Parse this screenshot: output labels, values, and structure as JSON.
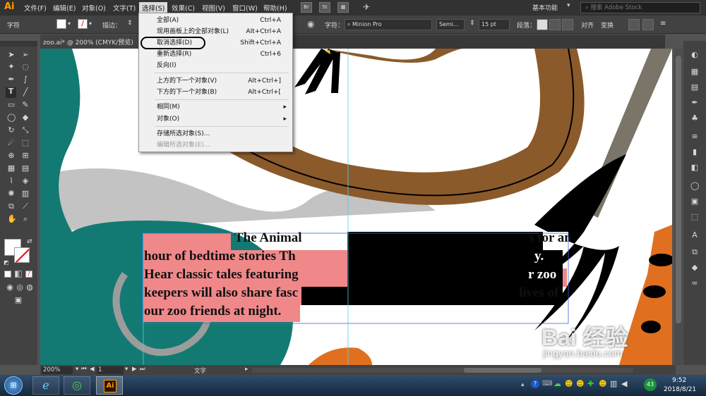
{
  "app": {
    "logo": "Ai"
  },
  "menubar": {
    "items": [
      "文件(F)",
      "编辑(E)",
      "对象(O)",
      "文字(T)",
      "选择(S)",
      "效果(C)",
      "视图(V)",
      "窗口(W)",
      "帮助(H)"
    ],
    "app_buttons": [
      "Br",
      "St"
    ],
    "workspace": "基本功能",
    "search_placeholder": "搜索 Adobe Stock"
  },
  "control": {
    "label_type": "字符",
    "stroke_label": "描边：",
    "char_label": "字符：",
    "font_name": "Minion Pro",
    "font_style": "Semi...",
    "font_size": "15 pt",
    "paragraph_label": "段落：",
    "align_label": "对齐",
    "transform_label": "变换"
  },
  "doc": {
    "tab_title": "zoo.ai* @ 200% (CMYK/预览)"
  },
  "dropdown": {
    "items": [
      {
        "label": "全部(A)",
        "shortcut": "Ctrl+A"
      },
      {
        "label": "现用画板上的全部对象(L)",
        "shortcut": "Alt+Ctrl+A"
      },
      {
        "label": "取消选择(D)",
        "shortcut": "Shift+Ctrl+A"
      },
      {
        "label": "重新选择(R)",
        "shortcut": "Ctrl+6"
      },
      {
        "label": "反向(I)",
        "shortcut": ""
      },
      {
        "label": "上方的下一个对象(V)",
        "shortcut": "Alt+Ctrl+]"
      },
      {
        "label": "下方的下一个对象(B)",
        "shortcut": "Alt+Ctrl+["
      },
      {
        "label": "相同(M)",
        "shortcut": "▸"
      },
      {
        "label": "对象(O)",
        "shortcut": "▸"
      },
      {
        "label": "存储所选对象(S)...",
        "shortcut": ""
      },
      {
        "label": "编辑所选对象(E)...",
        "shortcut": ""
      }
    ]
  },
  "artwork": {
    "lines": [
      "The Animal",
      "s for an",
      "hour of bedtime stories Th",
      "y.",
      "Hear classic tales featuring",
      "r zoo",
      "keepers will also share fasc",
      "lives of",
      "our zoo friends at night."
    ]
  },
  "status": {
    "zoom": "200%",
    "artboard": "1",
    "tool": "文字"
  },
  "taskbar": {
    "time": "9:52",
    "date": "2018/8/21",
    "badge": "43",
    "active_app": "Ai"
  },
  "watermark": {
    "brand": "Bai 经验",
    "url": "jingyan.baidu.com"
  },
  "colors": {
    "accent": "#ff9a00",
    "teal": "#137a73",
    "brown": "#8b5a2b",
    "pink": "#f0888a"
  }
}
